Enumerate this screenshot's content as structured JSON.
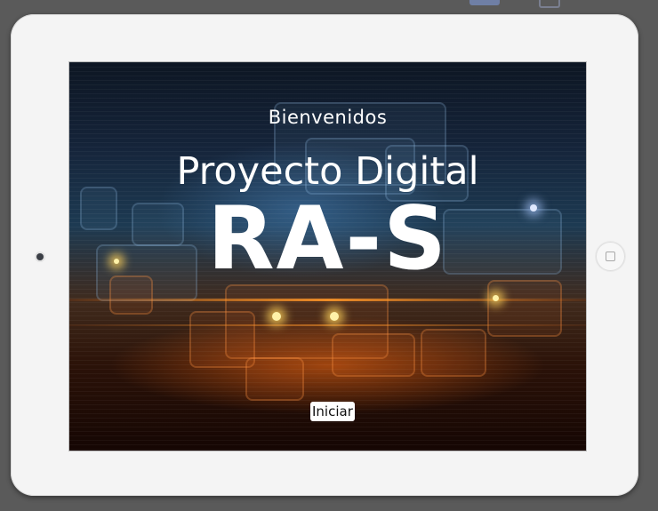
{
  "screen": {
    "welcome_text": "Bienvenidos",
    "subtitle": "Proyecto Digital",
    "title": "RA-S",
    "start_button_label": "Iniciar"
  },
  "device": {
    "frame_color": "#f4f4f4",
    "camera_icon": "camera-icon",
    "home_button_icon": "home-button-icon"
  },
  "colors": {
    "accent_glow": "#ff8a1e",
    "text": "#ffffff",
    "button_bg": "#ffffff"
  }
}
